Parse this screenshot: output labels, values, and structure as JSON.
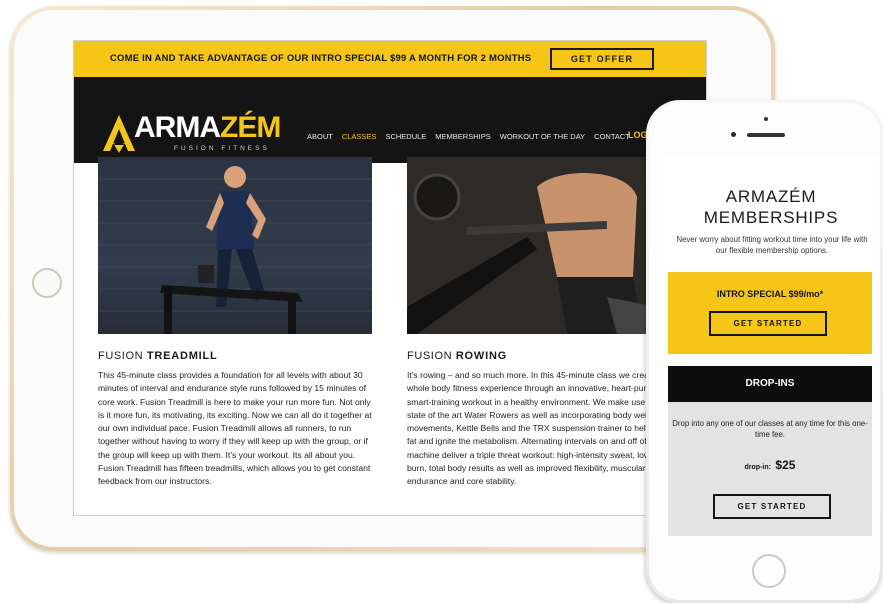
{
  "tablet_site": {
    "promo": {
      "text": "COME IN AND TAKE ADVANTAGE OF OUR INTRO SPECIAL $99 A MONTH FOR 2 MONTHS",
      "button": "GET OFFER"
    },
    "logo": {
      "part1": "ARMA",
      "part2": "ZÉM",
      "tagline": "FUSION FITNESS"
    },
    "nav": {
      "links": [
        "ABOUT",
        "CLASSES",
        "SCHEDULE",
        "MEMBERSHIPS",
        "WORKOUT OF THE DAY",
        "CONTACT"
      ],
      "active": "CLASSES",
      "login": "LOGIN | JOIN"
    },
    "cards": [
      {
        "title_prefix": "FUSION ",
        "title_bold": "TREADMILL",
        "body": "This 45-minute class provides a foundation for all levels with about 30 minutes of interval and endurance style runs followed by 15 minutes of core work. Fusion Treadmill is here to make your run more fun. Not only is it more fun, its motivating, its exciting. Now we can all do it together at our own individual pace. Fusion Treadmill allows all runners, to run together without having to worry if they will keep up with the group, or if the group will keep up with them. It's your workout. Its all about you. Fusion Treadmill has fifteen treadmills, which allows you to get constant feedback from our instructors."
      },
      {
        "title_prefix": "FUSION ",
        "title_bold": "ROWING",
        "body": "It's rowing – and so much more. In this 45-minute class we create the whole body fitness experience through an innovative, heart-pumping, smart-training workout in a healthy environment. We make use of the state of the art Water Rowers as well as incorporating body weight movements, Kettle Bells and the TRX suspension trainer to help torch fat and ignite the metabolism. Alternating intervals on and off of the row machine deliver a triple threat workout: high-intensity sweat, low-impact burn, total body results as well as improved flexibility, muscular endurance and core stability."
      }
    ]
  },
  "phone_site": {
    "title_line1": "ARMAZÉM",
    "title_line2": "MEMBERSHIPS",
    "description": "Never worry about fitting workout time into your life with our flexible membership options.",
    "intro_special": "INTRO SPECIAL $99/mo*",
    "get_started": "GET STARTED",
    "dropins_heading": "DROP-INS",
    "dropins_text": "Drop into any one of our classes at any time for this one-time fee.",
    "dropin_label": "drop-in:",
    "dropin_price": "$25",
    "get_started_2": "GET STARTED"
  },
  "colors": {
    "accent": "#f5c518",
    "dark": "#141414"
  }
}
